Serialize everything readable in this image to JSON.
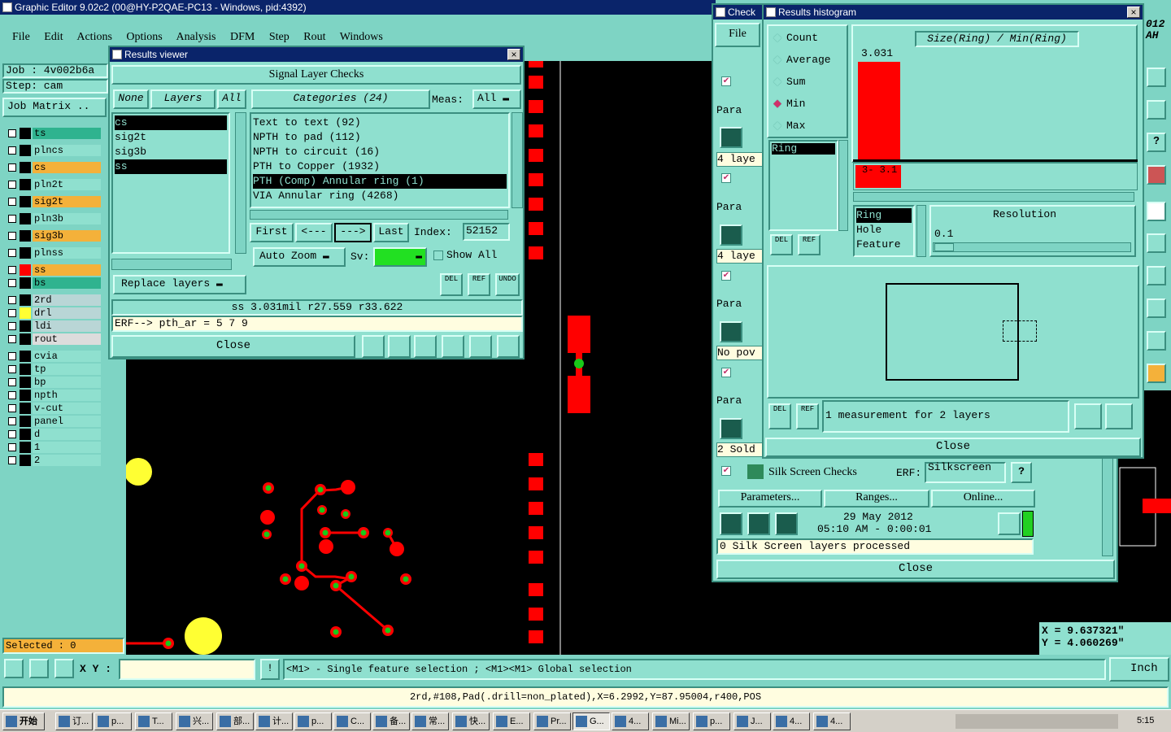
{
  "main_window": {
    "title": "Graphic Editor 9.02c2 (00@HY-P2QAE-PC13 - Windows, pid:4392)",
    "menu": [
      "File",
      "Edit",
      "Actions",
      "Options",
      "Analysis",
      "DFM",
      "Step",
      "Rout",
      "Windows"
    ],
    "job_label": "Job : 4v002b6a",
    "step_label": "Step: cam",
    "job_matrix_button": "Job Matrix ..",
    "layers": [
      {
        "name": "ts",
        "color": "#2fb38f"
      },
      {
        "name": "plncs",
        "color": "#8fe0cf"
      },
      {
        "name": "cs",
        "color": "#f4b13a"
      },
      {
        "name": "pln2t",
        "color": "#8fe0cf"
      },
      {
        "name": "sig2t",
        "color": "#f4b13a"
      },
      {
        "name": "pln3b",
        "color": "#8fe0cf"
      },
      {
        "name": "sig3b",
        "color": "#f4b13a"
      },
      {
        "name": "plnss",
        "color": "#8fe0cf"
      },
      {
        "name": "ss",
        "color": "#f4b13a"
      },
      {
        "name": "bs",
        "color": "#2fb38f"
      },
      {
        "name": "2rd",
        "color": "#b9d6d6"
      },
      {
        "name": "drl",
        "color": "#b9d6d6"
      },
      {
        "name": "ldi",
        "color": "#b9d6d6"
      },
      {
        "name": "rout",
        "color": "#dcdcdc"
      },
      {
        "name": "cvia",
        "color": "#8fe0cf"
      },
      {
        "name": "tp",
        "color": "#8fe0cf"
      },
      {
        "name": "bp",
        "color": "#8fe0cf"
      },
      {
        "name": "npth",
        "color": "#8fe0cf"
      },
      {
        "name": "v-cut",
        "color": "#8fe0cf"
      },
      {
        "name": "panel",
        "color": "#8fe0cf"
      },
      {
        "name": "d",
        "color": "#8fe0cf"
      },
      {
        "name": "1",
        "color": "#8fe0cf"
      },
      {
        "name": "2",
        "color": "#8fe0cf"
      }
    ],
    "selected_label": "Selected : 0",
    "xy_label": "X Y :",
    "xy_value": "",
    "hint": "<M1> - Single feature selection ; <M1><M1> Global selection",
    "units": "Inch",
    "status_line": "2rd,#108,Pad(.drill=non_plated),X=6.2992,Y=87.95004,r400,POS",
    "coord_x": "X = 9.637321\"",
    "coord_y": "Y = 4.060269\"",
    "corner_text1": "012",
    "corner_text2": "AH"
  },
  "results_viewer": {
    "title": "Results viewer",
    "header": "Signal Layer Checks",
    "none_btn": "None",
    "layers_btn": "Layers",
    "all_btn": "All",
    "categories_btn": "Categories (24)",
    "meas_label": "Meas:",
    "meas_value": "All",
    "layer_list": [
      "cs",
      "sig2t",
      "sig3b",
      "ss"
    ],
    "category_list": [
      "Text to text (92)",
      "NPTH to pad (112)",
      "NPTH to circuit (16)",
      "PTH to Copper (1932)",
      "PTH (Comp) Annular ring (1)",
      "VIA Annular ring (4268)"
    ],
    "first_btn": "First",
    "prev_btn": "<---",
    "next_btn": "--->",
    "last_btn": "Last",
    "index_label": "Index:",
    "index_value": "52152",
    "auto_zoom": "Auto Zoom",
    "sv_label": "Sv:",
    "show_all": "Show All",
    "replace_layers": "Replace layers",
    "del": "DEL",
    "ref": "REF",
    "undo": "UNDO",
    "measurement": "ss 3.031mil  r27.559  r33.622",
    "erf_line": "ERF--> pth_ar = 5 7 9",
    "close": "Close"
  },
  "histogram": {
    "title": "Results histogram",
    "options": [
      "Count",
      "Average",
      "Sum",
      "Min",
      "Max"
    ],
    "selected_option": "Min",
    "size_label": "Size(Ring) / Min(Ring)",
    "bar_value_label": "3.031",
    "bar_range_label": "3- 3.1",
    "list_left": [
      "Ring"
    ],
    "list_types": [
      "Ring",
      "Hole",
      "Feature"
    ],
    "resolution_label": "Resolution",
    "resolution_value": "0.1",
    "status": "1 measurement for 2 layers",
    "close": "Close"
  },
  "checklist": {
    "title": "Check",
    "file": "File",
    "rows": [
      "Para",
      "4 laye",
      "Para",
      "4 laye",
      "Para",
      "No pov",
      "Para",
      "2 Sold"
    ],
    "silk_label": "Silk Screen Checks",
    "erf_label": "ERF:",
    "erf_value": "Silkscreen",
    "question": "?",
    "params_btn": "Parameters...",
    "ranges_btn": "Ranges...",
    "online_btn": "Online...",
    "date": "29 May 2012",
    "time": "05:10 AM - 0:00:01",
    "processed": "0 Silk Screen layers processed",
    "close": "Close"
  },
  "taskbar": {
    "start": "开始",
    "items": [
      "订...",
      "p...",
      "T...",
      "兴...",
      "部...",
      "计...",
      "p...",
      "C...",
      "备...",
      "常...",
      "快...",
      "E...",
      "Pr...",
      "G...",
      "4...",
      "Mi...",
      "p...",
      "J...",
      "4...",
      "4..."
    ],
    "clock": "5:15"
  }
}
